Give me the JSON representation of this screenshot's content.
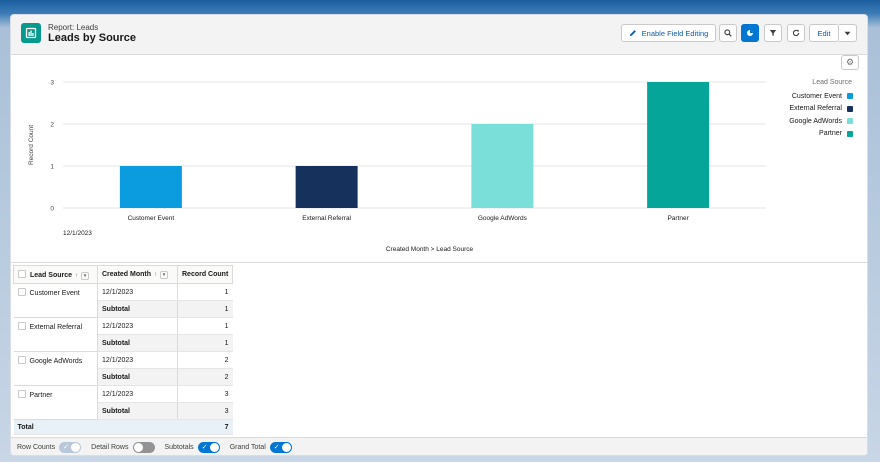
{
  "header": {
    "eyebrow": "Report: Leads",
    "title": "Leads by Source",
    "enable_field_editing": "Enable Field Editing",
    "edit": "Edit"
  },
  "chart_data": {
    "type": "bar",
    "categories": [
      "Customer Event",
      "External Referral",
      "Google AdWords",
      "Partner"
    ],
    "group_label": "12/1/2023",
    "values": [
      1,
      1,
      2,
      3
    ],
    "colors": [
      "#0b9ce0",
      "#16325c",
      "#7adfd9",
      "#06a59a"
    ],
    "xlabel": "Created Month > Lead Source",
    "ylabel": "Record Count",
    "ylim": [
      0,
      3
    ],
    "yticks": [
      "0",
      "1",
      "2",
      "3"
    ],
    "grid": true,
    "legend_title": "Lead Source",
    "legend_placement": "right"
  },
  "table": {
    "headers": [
      "Lead Source",
      "Created Month",
      "Record Count"
    ],
    "subtotal_label": "Subtotal",
    "total_label": "Total",
    "total_value": "7",
    "groups": [
      {
        "source": "Customer Event",
        "month": "12/1/2023",
        "count": "1",
        "subtotal": "1"
      },
      {
        "source": "External Referral",
        "month": "12/1/2023",
        "count": "1",
        "subtotal": "1"
      },
      {
        "source": "Google AdWords",
        "month": "12/1/2023",
        "count": "2",
        "subtotal": "2"
      },
      {
        "source": "Partner",
        "month": "12/1/2023",
        "count": "3",
        "subtotal": "3"
      }
    ]
  },
  "footer": {
    "row_counts": "Row Counts",
    "detail_rows": "Detail Rows",
    "subtotals": "Subtotals",
    "grand_total": "Grand Total"
  }
}
